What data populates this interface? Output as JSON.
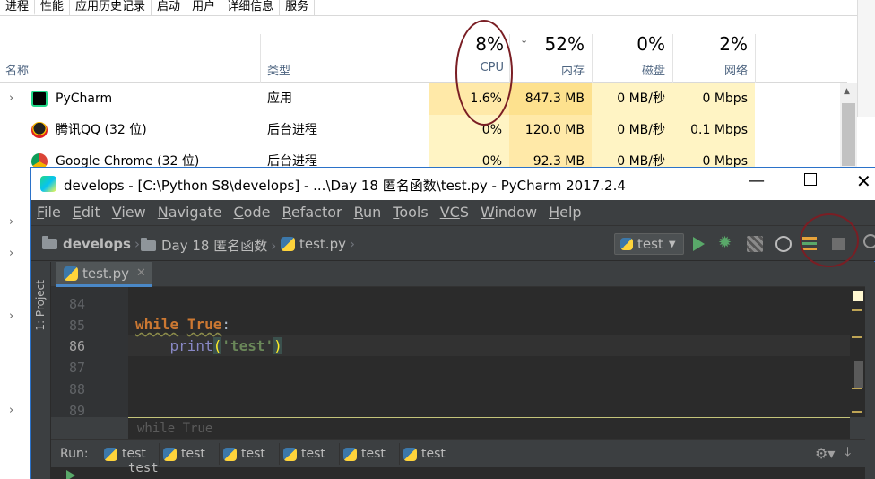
{
  "task_manager": {
    "tabs": [
      "进程",
      "性能",
      "应用历史记录",
      "启动",
      "用户",
      "详细信息",
      "服务"
    ],
    "columns": {
      "name": "名称",
      "type": "类型",
      "cpu": {
        "pct": "8%",
        "label": "CPU"
      },
      "memory": {
        "pct": "52%",
        "label": "内存"
      },
      "disk": {
        "pct": "0%",
        "label": "磁盘"
      },
      "network": {
        "pct": "2%",
        "label": "网络"
      }
    },
    "rows": [
      {
        "name": "PyCharm",
        "type": "应用",
        "cpu": "1.6%",
        "memory": "847.3 MB",
        "disk": "0 MB/秒",
        "network": "0 Mbps",
        "icon": "pycharm-icon"
      },
      {
        "name": "腾讯QQ (32 位)",
        "type": "后台进程",
        "cpu": "0%",
        "memory": "120.0 MB",
        "disk": "0 MB/秒",
        "network": "0.1 Mbps",
        "icon": "qq-icon"
      },
      {
        "name": "Google Chrome (32 位)",
        "type": "后台进程",
        "cpu": "0%",
        "memory": "92.3 MB",
        "disk": "0 MB/秒",
        "network": "0 Mbps",
        "icon": "chrome-icon"
      }
    ]
  },
  "pycharm": {
    "title": "develops - [C:\\Python S8\\develops] - ...\\Day 18 匿名函数\\test.py - PyCharm 2017.2.4",
    "menu": [
      {
        "u": "F",
        "rest": "ile"
      },
      {
        "u": "E",
        "rest": "dit"
      },
      {
        "u": "V",
        "rest": "iew"
      },
      {
        "u": "N",
        "rest": "avigate"
      },
      {
        "u": "C",
        "rest": "ode"
      },
      {
        "u": "R",
        "rest": "efactor"
      },
      {
        "u": "R",
        "rest": "un"
      },
      {
        "u": "T",
        "rest": "ools"
      },
      {
        "u": "VC",
        "rest": "S"
      },
      {
        "u": "W",
        "rest": "indow"
      },
      {
        "u": "H",
        "rest": "elp"
      }
    ],
    "breadcrumbs": [
      "develops",
      "Day 18 匿名函数",
      "test.py"
    ],
    "run_config": "test",
    "project_strip_label": "1: Project",
    "editor_tab": "test.py",
    "line_numbers": [
      "84",
      "85",
      "86",
      "87",
      "88",
      "89"
    ],
    "code": {
      "line85_kw1": "while",
      "line85_kw2": "True",
      "line85_colon": ":",
      "line86_indent": "    ",
      "line86_fn": "print",
      "line86_open": "(",
      "line86_str": "'test'",
      "line86_close": ")"
    },
    "code_breadcrumb": "while True",
    "run_panel": {
      "label": "Run:",
      "tabs": [
        "test",
        "test",
        "test",
        "test",
        "test",
        "test"
      ],
      "console_line": "test"
    }
  }
}
